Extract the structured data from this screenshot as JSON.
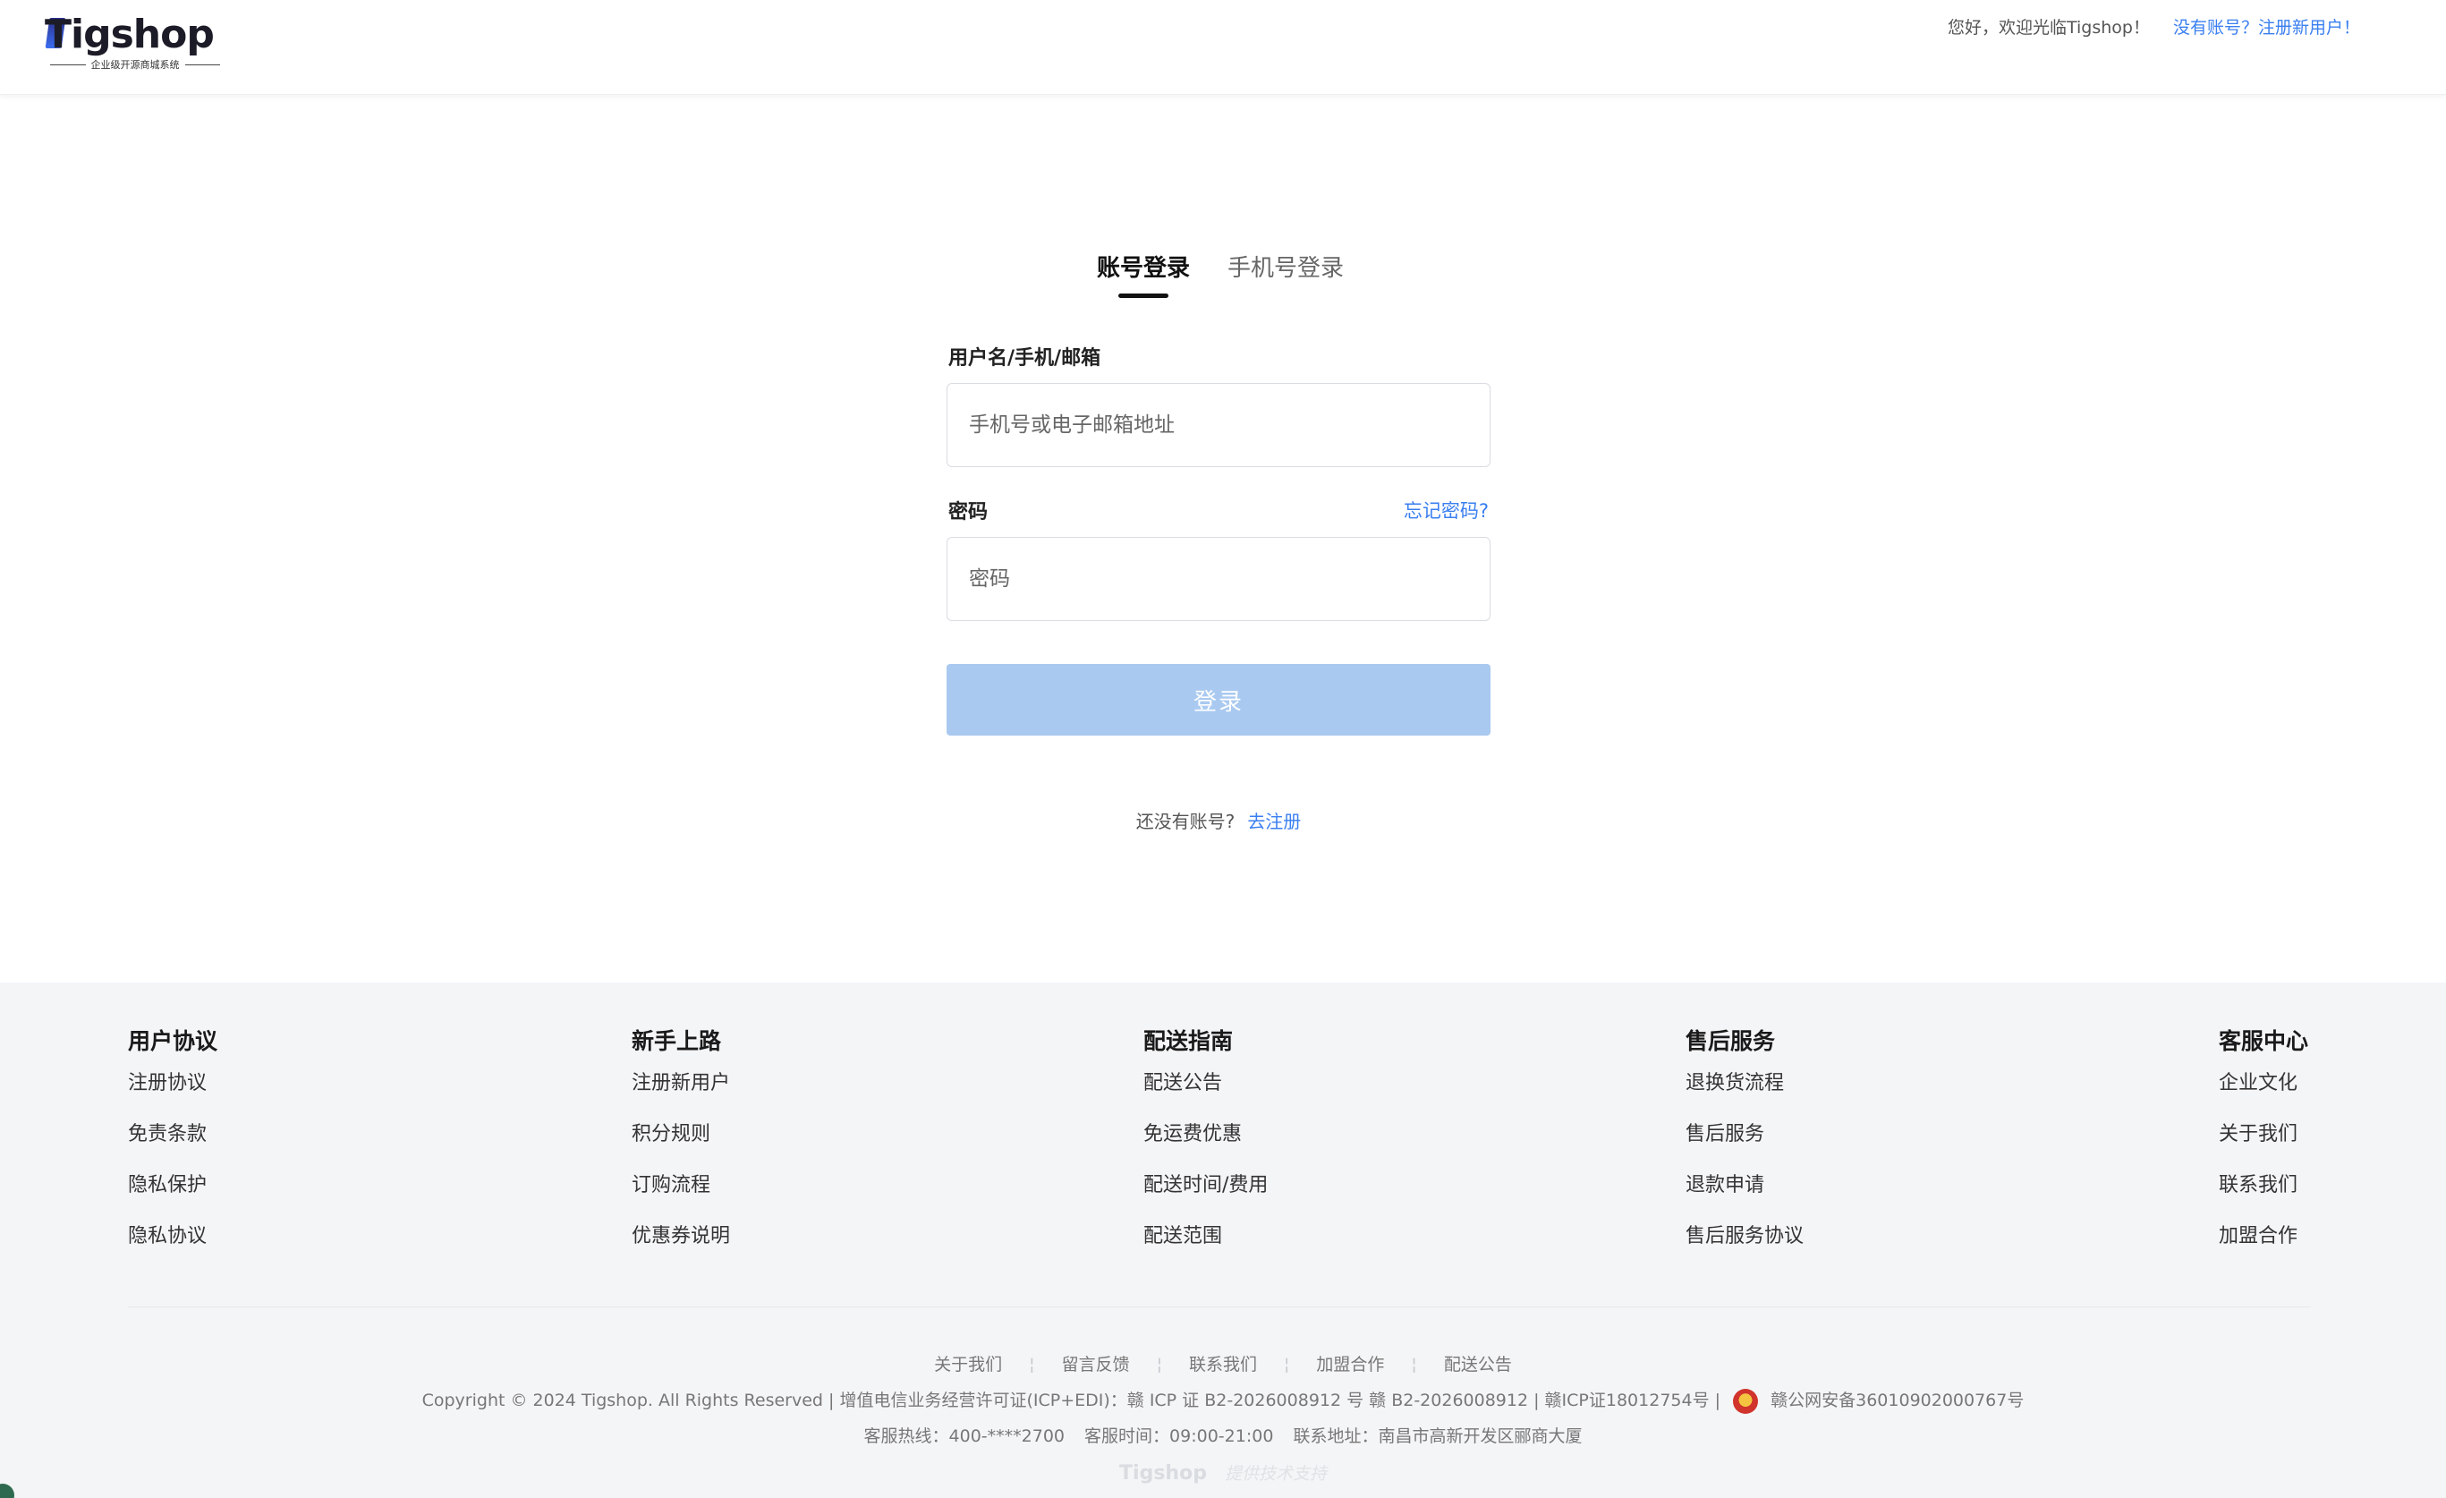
{
  "header": {
    "logo_text": "Tigshop",
    "logo_tagline": "企业级开源商城系统",
    "welcome": "您好，欢迎光临Tigshop！",
    "register_link": "没有账号？注册新用户！"
  },
  "login": {
    "tabs": [
      {
        "label": "账号登录",
        "active": true
      },
      {
        "label": "手机号登录",
        "active": false
      }
    ],
    "username_label": "用户名/手机/邮箱",
    "username_placeholder": "手机号或电子邮箱地址",
    "password_label": "密码",
    "forgot_link": "忘记密码?",
    "password_placeholder": "密码",
    "submit_label": "登录",
    "no_account_text": "还没有账号?",
    "go_register": "去注册"
  },
  "footer": {
    "columns": [
      {
        "title": "用户协议",
        "links": [
          "注册协议",
          "免责条款",
          "隐私保护",
          "隐私协议"
        ]
      },
      {
        "title": "新手上路",
        "links": [
          "注册新用户",
          "积分规则",
          "订购流程",
          "优惠券说明"
        ]
      },
      {
        "title": "配送指南",
        "links": [
          "配送公告",
          "免运费优惠",
          "配送时间/费用",
          "配送范围"
        ]
      },
      {
        "title": "售后服务",
        "links": [
          "退换货流程",
          "售后服务",
          "退款申请",
          "售后服务协议"
        ]
      },
      {
        "title": "客服中心",
        "links": [
          "企业文化",
          "关于我们",
          "联系我们",
          "加盟合作"
        ]
      }
    ],
    "bottom_links": [
      "关于我们",
      "留言反馈",
      "联系我们",
      "加盟合作",
      "配送公告"
    ],
    "copyright": "Copyright © 2024 Tigshop. All Rights Reserved | 增值电信业务经营许可证(ICP+EDI)：赣 ICP 证 B2-2026008912 号 赣 B2-2026008912 | 赣ICP证18012754号  |",
    "police_record": "赣公网安备36010902000767号",
    "hotline": "客服热线：400-****2700",
    "service_time": "客服时间：09:00-21:00",
    "address": "联系地址：南昌市高新开发区郦商大厦",
    "powered_brand": "Tigshop",
    "powered_text": "提供技术支持"
  },
  "colors": {
    "accent": "#3a7ff0",
    "button_disabled": "#a9c9f0",
    "footer_bg": "#f4f5f7"
  }
}
